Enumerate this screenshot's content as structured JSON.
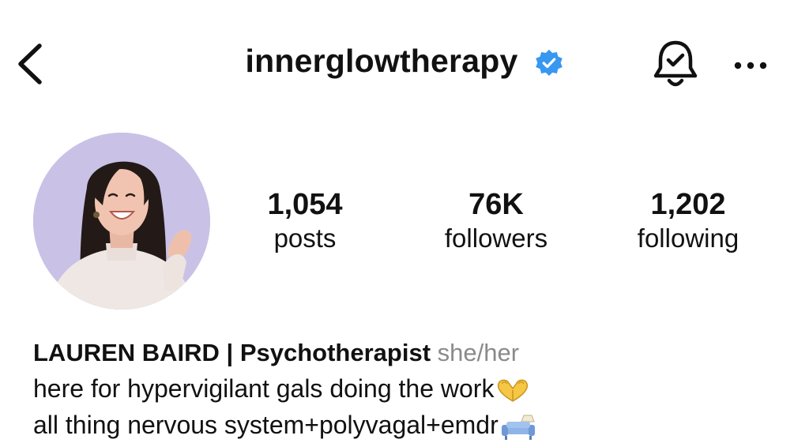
{
  "header": {
    "username": "innerglowtherapy",
    "verified": true,
    "icons": {
      "back": "chevron-left-icon",
      "verified": "verified-badge-icon",
      "notifications": "bell-check-icon",
      "more": "more-horizontal-icon"
    },
    "accent_color": "#3897f0"
  },
  "profile": {
    "avatar_background": "#c9c2e6",
    "stats": [
      {
        "value": "1,054",
        "label": "posts"
      },
      {
        "value": "76K",
        "label": "followers"
      },
      {
        "value": "1,202",
        "label": "following"
      }
    ]
  },
  "bio": {
    "name": "LAUREN BAIRD | Psychotherapist",
    "pronouns": "she/her",
    "lines": [
      {
        "text": "here for hypervigilant gals doing the work",
        "emoji": "heart-hands-icon"
      },
      {
        "text": "all thing nervous system+polyvagal+emdr",
        "emoji": "couch-and-lamp-icon"
      }
    ],
    "pronoun_color": "#8a8a8a"
  }
}
